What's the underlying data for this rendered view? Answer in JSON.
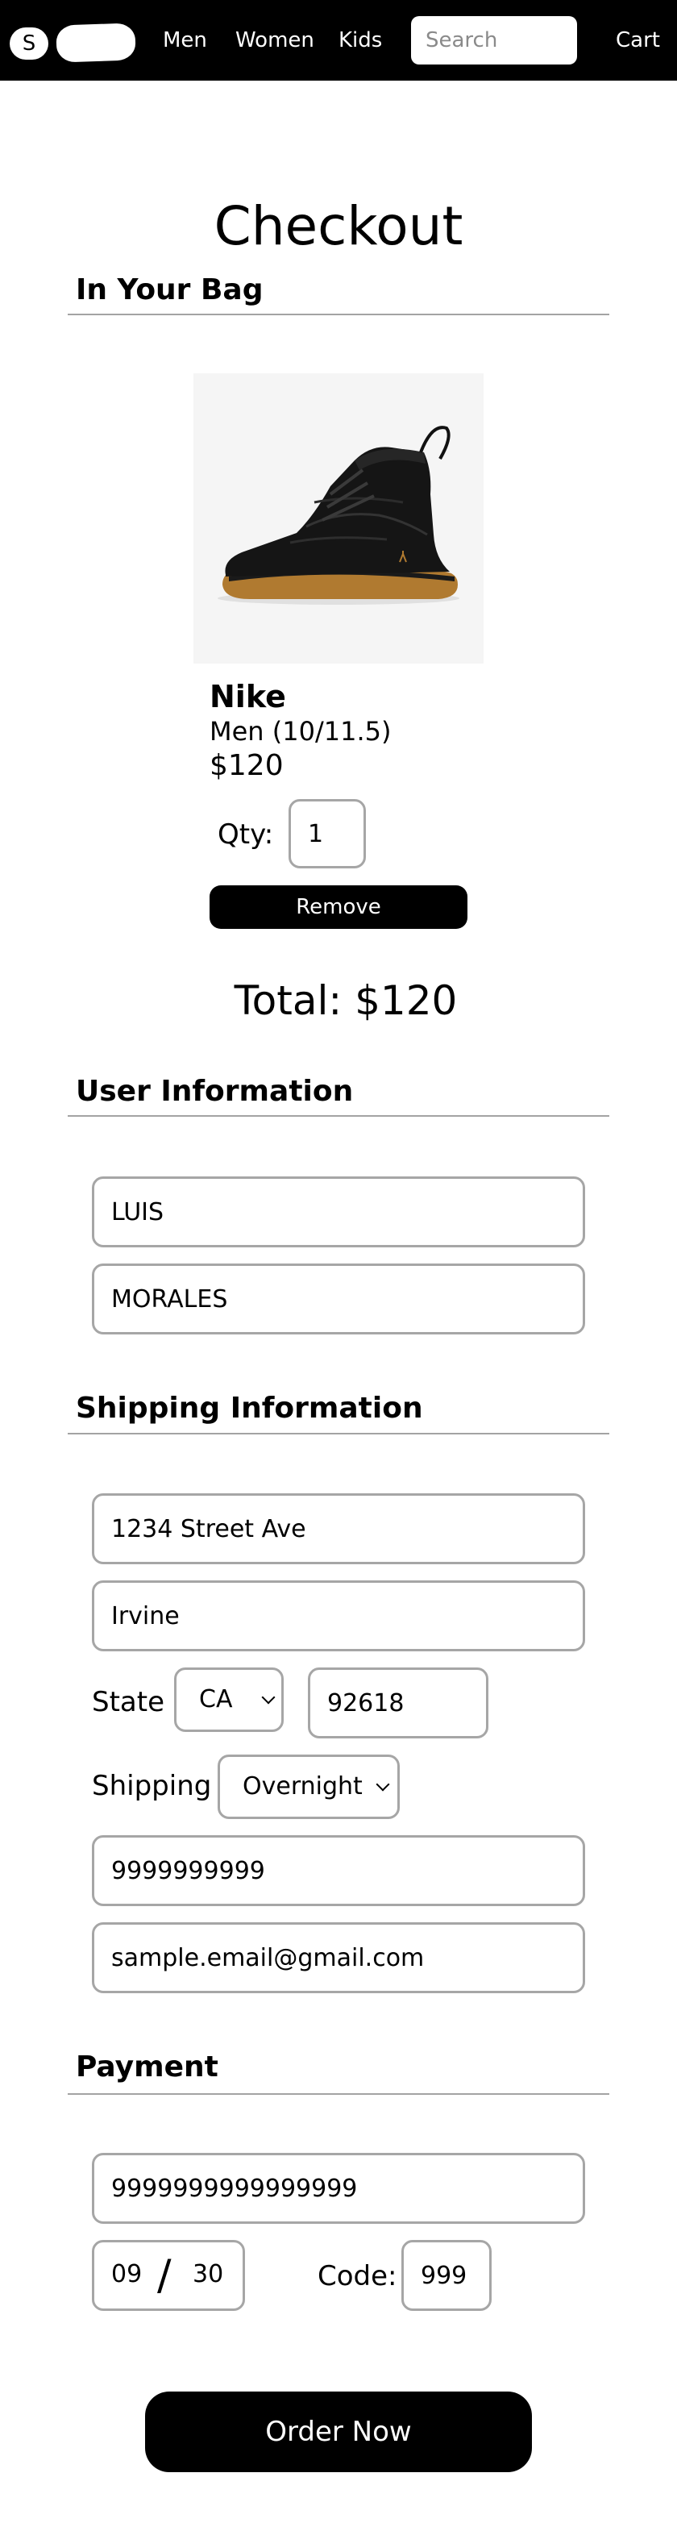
{
  "navbar": {
    "logo_letter": "S",
    "links": [
      "Men",
      "Women",
      "Kids"
    ],
    "search_placeholder": "Search",
    "cart_label": "Cart"
  },
  "page_title": "Checkout",
  "bag": {
    "heading": "In Your Bag",
    "item": {
      "brand": "Nike",
      "variant": "Men (10/11.5)",
      "price": "$120",
      "qty_label": "Qty:",
      "qty": "1",
      "remove_label": "Remove",
      "image_icon": "black-boot-image"
    },
    "total": "Total: $120"
  },
  "user": {
    "heading": "User Information",
    "first_name": "LUIS",
    "last_name": "MORALES"
  },
  "shipping": {
    "heading": "Shipping Information",
    "street": "1234 Street Ave",
    "city": "Irvine",
    "state_label": "State",
    "state": "CA",
    "zip": "92618",
    "method_label": "Shipping",
    "method": "Overnight",
    "phone": "9999999999",
    "email": "sample.email@gmail.com"
  },
  "payment": {
    "heading": "Payment",
    "card_number": "9999999999999999",
    "exp_month": "09",
    "exp_separator": "/",
    "exp_year": "30",
    "code_label": "Code:",
    "code": "999"
  },
  "order_label": "Order Now"
}
